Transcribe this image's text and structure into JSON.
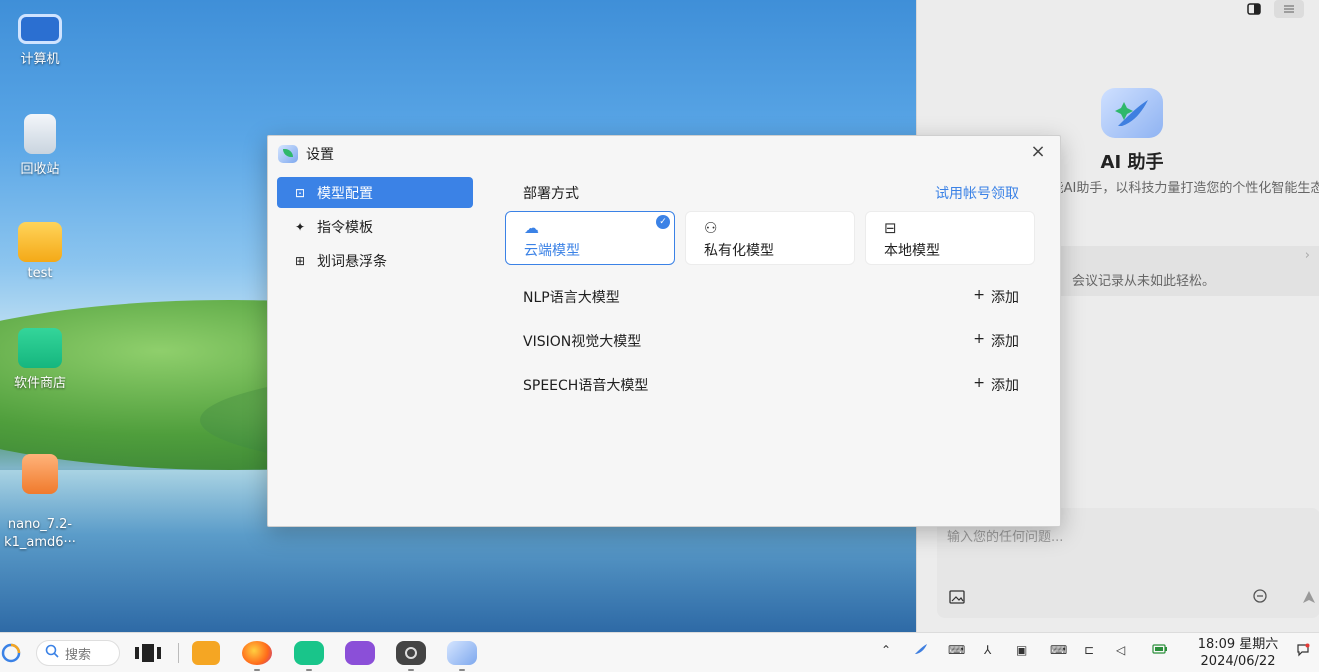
{
  "desktop": {
    "icons": [
      {
        "label": "计算机"
      },
      {
        "label": "回收站"
      },
      {
        "label": "test"
      },
      {
        "label": "软件商店"
      },
      {
        "label": "nano_7.2-\nk1_amd6···"
      }
    ]
  },
  "ai_panel": {
    "title": "AI 助手",
    "description": "全能AI助手，以科技力量打造您的个性化智能生态。",
    "card_text": "会议记录从未如此轻松。",
    "input_placeholder": "输入您的任何问题..."
  },
  "dialog": {
    "title": "设置",
    "close_symbol": "×",
    "sidebar": [
      {
        "label": "模型配置",
        "icon": "model-icon",
        "glyph": "⊡",
        "active": true
      },
      {
        "label": "指令模板",
        "icon": "sparkle-icon",
        "glyph": "✦",
        "active": false
      },
      {
        "label": "划词悬浮条",
        "icon": "grid-icon",
        "glyph": "⊞",
        "active": false
      }
    ],
    "deployment": {
      "heading": "部署方式",
      "trial_link": "试用帐号领取",
      "options": [
        {
          "label": "云端模型",
          "icon": "cloud-icon",
          "glyph": "☁",
          "selected": true
        },
        {
          "label": "私有化模型",
          "icon": "user-settings-icon",
          "glyph": "⚇",
          "selected": false
        },
        {
          "label": "本地模型",
          "icon": "laptop-settings-icon",
          "glyph": "⊟",
          "selected": false
        }
      ]
    },
    "models": [
      {
        "label": "NLP语言大模型",
        "action": "添加"
      },
      {
        "label": "VISION视觉大模型",
        "action": "添加"
      },
      {
        "label": "SPEECH语音大模型",
        "action": "添加"
      }
    ],
    "add_symbol": "+"
  },
  "taskbar": {
    "search_placeholder": "搜索",
    "time": "18:09 星期六",
    "date": "2024/06/22"
  },
  "colors": {
    "accent": "#3b82e6",
    "dialog_bg": "#f6f6f6",
    "panel_bg": "#ececec"
  }
}
